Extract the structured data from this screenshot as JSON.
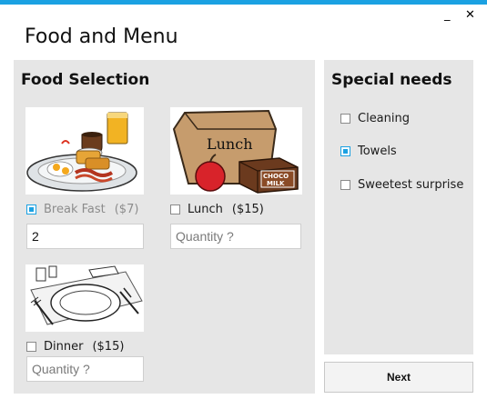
{
  "window": {
    "title": "Food and Menu",
    "minimize_glyph": "_",
    "close_glyph": "✕",
    "accent_color": "#1ba1e2"
  },
  "food_selection": {
    "heading": "Food Selection",
    "items": [
      {
        "label": "Break Fast",
        "price": "($7)",
        "checked": true,
        "enabled": false,
        "quantity_value": "2",
        "quantity_placeholder": "Quantity ?"
      },
      {
        "label": "Lunch",
        "price": "($15)",
        "checked": false,
        "enabled": true,
        "quantity_value": "",
        "quantity_placeholder": "Quantity ?",
        "image_text": [
          "Lunch",
          "CHOCO",
          "MILK"
        ]
      },
      {
        "label": "Dinner",
        "price": "($15)",
        "checked": false,
        "enabled": true,
        "quantity_value": "",
        "quantity_placeholder": "Quantity ?"
      }
    ]
  },
  "special_needs": {
    "heading": "Special needs",
    "options": [
      {
        "label": "Cleaning",
        "checked": false
      },
      {
        "label": "Towels",
        "checked": true
      },
      {
        "label": "Sweetest surprise",
        "checked": false
      }
    ]
  },
  "next_label": "Next"
}
